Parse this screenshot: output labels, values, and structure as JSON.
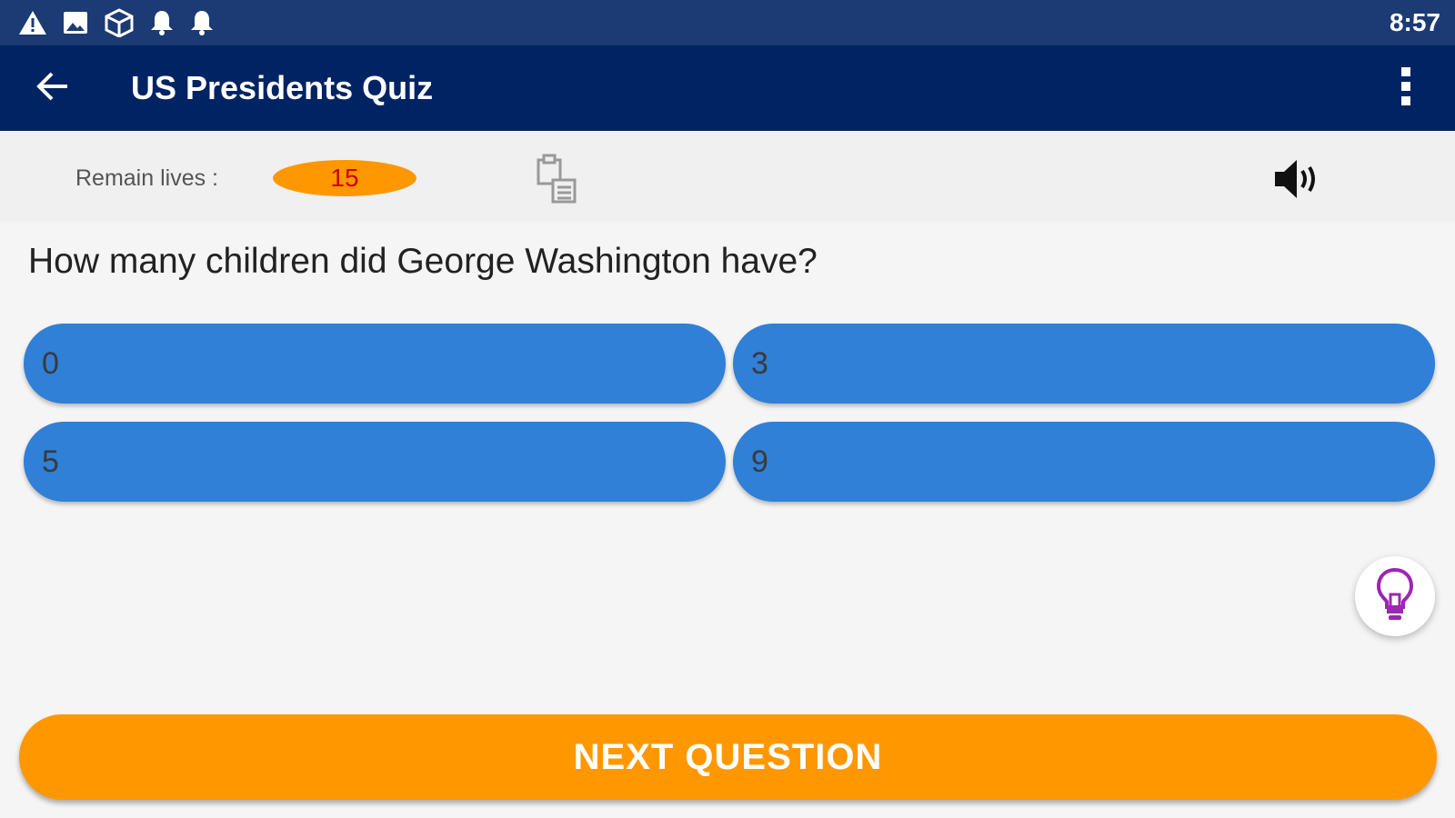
{
  "status_bar": {
    "icons": [
      "warning-icon",
      "image-icon",
      "cube-icon",
      "bell-icon",
      "bell-icon"
    ],
    "time": "8:57"
  },
  "app_bar": {
    "title": "US Presidents Quiz",
    "back_icon": "arrow-back-icon",
    "menu_icon": "more-vert-icon"
  },
  "info": {
    "lives_label": "Remain lives :",
    "lives_value": "15",
    "clipboard_icon": "clipboard-list-icon",
    "sound_icon": "speaker-icon"
  },
  "quiz": {
    "question": "How many children did George Washington have?",
    "answers": [
      {
        "label": "0"
      },
      {
        "label": "3"
      },
      {
        "label": "5"
      },
      {
        "label": "9"
      }
    ],
    "hint_icon": "lightbulb-icon",
    "next_label": "NEXT QUESTION"
  },
  "colors": {
    "status_bar": "#1c3a73",
    "app_bar": "#002363",
    "answer_button": "#2f80d6",
    "accent": "#ff9800",
    "lives_text": "#cc0000",
    "hint_bulb": "#9c27b0"
  }
}
